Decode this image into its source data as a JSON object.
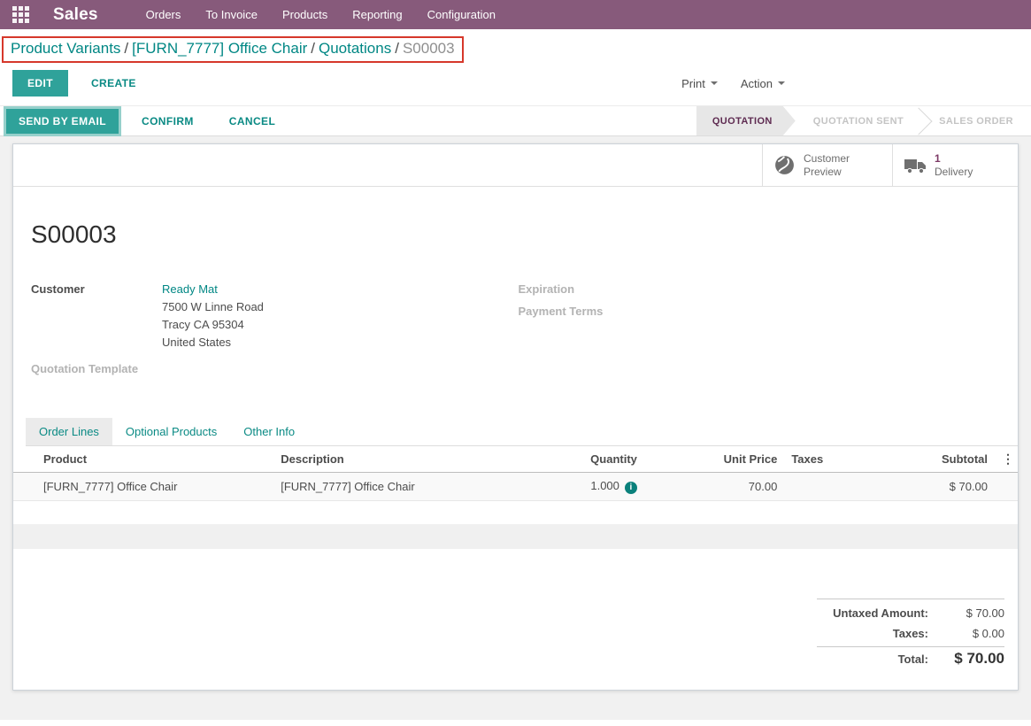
{
  "navbar": {
    "brand": "Sales",
    "menu_items": [
      "Orders",
      "To Invoice",
      "Products",
      "Reporting",
      "Configuration"
    ]
  },
  "breadcrumb": {
    "separator": "/",
    "links": [
      "Product Variants",
      "[FURN_7777] Office Chair",
      "Quotations"
    ],
    "current": "S00003"
  },
  "control_panel": {
    "edit": "EDIT",
    "create": "CREATE",
    "print": "Print",
    "action": "Action"
  },
  "statusbar": {
    "send_by_email": "SEND BY EMAIL",
    "confirm": "CONFIRM",
    "cancel": "CANCEL",
    "states": [
      {
        "label": "QUOTATION",
        "active": true
      },
      {
        "label": "QUOTATION SENT",
        "active": false
      },
      {
        "label": "SALES ORDER",
        "active": false
      }
    ]
  },
  "smart_buttons": {
    "customer_preview": {
      "label": "Customer Preview"
    },
    "delivery": {
      "count": "1",
      "label": "Delivery"
    }
  },
  "record": {
    "name": "S00003",
    "customer_label": "Customer",
    "customer_name": "Ready Mat",
    "address": [
      "7500 W Linne Road",
      "Tracy CA 95304",
      "United States"
    ],
    "quotation_template_label": "Quotation Template",
    "expiration_label": "Expiration",
    "payment_terms_label": "Payment Terms"
  },
  "tabs": [
    {
      "label": "Order Lines",
      "active": true
    },
    {
      "label": "Optional Products",
      "active": false
    },
    {
      "label": "Other Info",
      "active": false
    }
  ],
  "order_lines": {
    "columns": [
      "Product",
      "Description",
      "Quantity",
      "Unit Price",
      "Taxes",
      "Subtotal"
    ],
    "rows": [
      {
        "product": "[FURN_7777] Office Chair",
        "description": "[FURN_7777] Office Chair",
        "quantity": "1.000",
        "unit_price": "70.00",
        "taxes": "",
        "subtotal": "$ 70.00"
      }
    ]
  },
  "totals": {
    "untaxed_amount_label": "Untaxed Amount:",
    "untaxed_amount": "$ 70.00",
    "taxes_label": "Taxes:",
    "taxes": "$ 0.00",
    "total_label": "Total:",
    "total": "$ 70.00"
  },
  "icons": {
    "info_glyph": "i",
    "dots_glyph": "⋮"
  },
  "colors": {
    "navbar": "#875a7b",
    "primary_button": "#2fa29a",
    "link": "#008784",
    "state_active_text": "#5e2b51",
    "annotation_border": "#d6382b",
    "delivery_count": "#7d3a66"
  }
}
